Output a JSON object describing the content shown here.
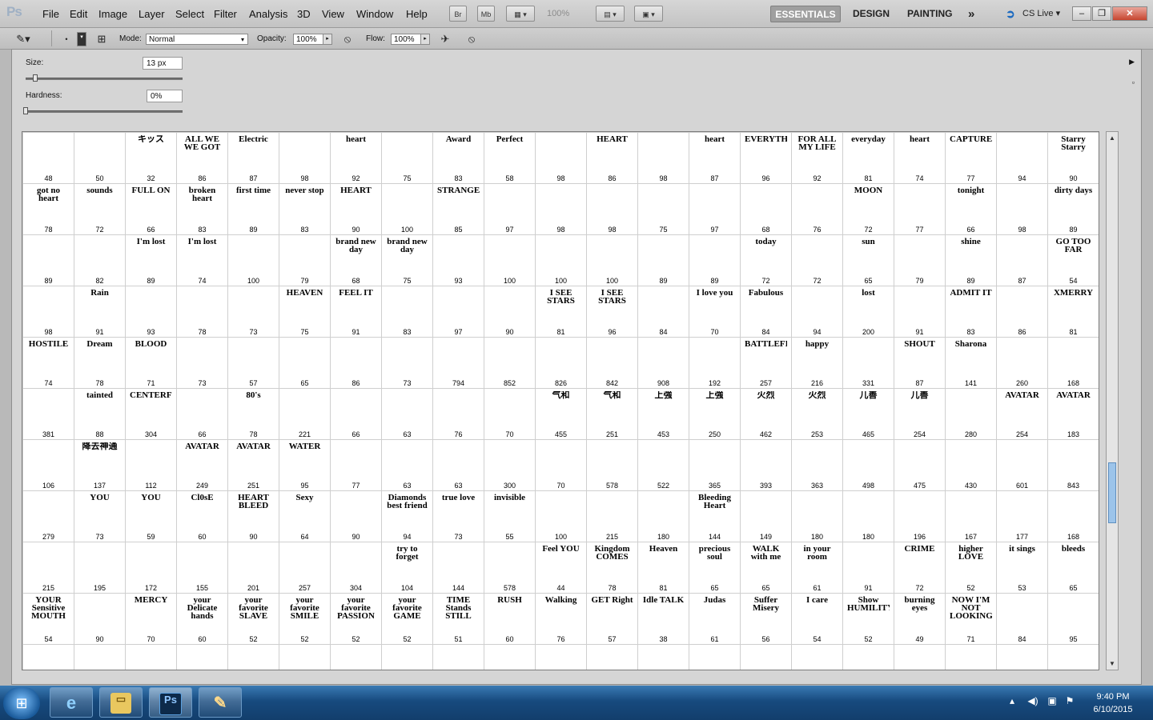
{
  "app": {
    "logo": "Ps"
  },
  "menu": [
    "File",
    "Edit",
    "Image",
    "Layer",
    "Select",
    "Filter",
    "Analysis",
    "3D",
    "View",
    "Window",
    "Help"
  ],
  "toolbar": {
    "bridge": "Br",
    "minibridge": "Mb",
    "zoom": "100%"
  },
  "workspaces": [
    "ESSENTIALS",
    "DESIGN",
    "PAINTING"
  ],
  "cs_live": "CS Live",
  "options": {
    "mode_label": "Mode:",
    "mode_value": "Normal",
    "opacity_label": "Opacity:",
    "opacity_value": "100%",
    "flow_label": "Flow:",
    "flow_value": "100%"
  },
  "brush_panel": {
    "size_label": "Size:",
    "size_value": "13 px",
    "hardness_label": "Hardness:",
    "hardness_value": "0%"
  },
  "brush_sizes": [
    [
      48,
      50,
      32,
      86,
      87,
      98,
      92,
      75,
      83,
      58,
      98,
      86,
      98,
      87,
      96,
      92,
      81,
      74,
      77,
      94,
      90
    ],
    [
      78,
      72,
      66,
      83,
      89,
      83,
      90,
      100,
      85,
      97,
      98,
      98,
      75,
      97,
      68,
      76,
      72,
      77,
      66,
      98,
      89
    ],
    [
      89,
      82,
      89,
      74,
      100,
      79,
      68,
      75,
      93,
      100,
      100,
      100,
      89,
      89,
      72,
      72,
      65,
      79,
      89,
      87,
      54
    ],
    [
      98,
      91,
      93,
      78,
      73,
      75,
      91,
      83,
      97,
      90,
      81,
      96,
      84,
      70,
      84,
      94,
      200,
      91,
      83,
      86,
      81
    ],
    [
      74,
      78,
      71,
      73,
      57,
      65,
      86,
      73,
      794,
      852,
      826,
      842,
      908,
      192,
      257,
      216,
      331,
      87,
      141,
      260,
      168
    ],
    [
      381,
      88,
      304,
      66,
      78,
      221,
      66,
      63,
      76,
      70,
      455,
      251,
      453,
      250,
      462,
      253,
      465,
      254,
      280,
      254,
      183
    ],
    [
      106,
      137,
      112,
      249,
      251,
      95,
      77,
      63,
      63,
      300,
      70,
      578,
      522,
      365,
      393,
      363,
      498,
      475,
      430,
      601,
      843
    ],
    [
      279,
      73,
      59,
      60,
      90,
      64,
      90,
      94,
      73,
      55,
      100,
      215,
      180,
      144,
      149,
      180,
      180,
      196,
      167,
      177,
      168
    ],
    [
      215,
      195,
      172,
      155,
      201,
      257,
      304,
      104,
      144,
      578,
      44,
      78,
      81,
      65,
      65,
      61,
      91,
      72,
      52,
      53,
      65
    ],
    [
      54,
      90,
      70,
      60,
      52,
      52,
      52,
      52,
      51,
      60,
      76,
      57,
      38,
      61,
      56,
      54,
      52,
      49,
      71,
      84,
      95
    ],
    [
      "",
      "",
      "",
      "",
      "",
      "",
      "",
      "",
      "",
      "",
      "",
      "",
      "",
      "",
      "",
      "",
      "",
      "",
      "",
      "",
      ""
    ]
  ],
  "brush_labels": [
    [
      "",
      "",
      "キッス",
      "ALL WE WE GOT",
      "Electric",
      "",
      "heart",
      "",
      "Award",
      "Perfect",
      "",
      "HEART",
      "",
      "heart",
      "EVERYTHING",
      "FOR ALL MY LIFE",
      "everyday",
      "heart",
      "CAPTURED",
      "",
      "Starry Starry"
    ],
    [
      "got no heart",
      "sounds",
      "FULL ON",
      "broken heart",
      "first time",
      "never stop",
      "HEART",
      "",
      "STRANGER",
      "",
      "",
      "",
      "",
      "",
      "",
      "",
      "MOON",
      "",
      "tonight",
      "",
      "dirty days"
    ],
    [
      "",
      "",
      "I'm lost",
      "I'm lost",
      "",
      "",
      "brand new day",
      "brand new day",
      "",
      "",
      "",
      "",
      "",
      "",
      "today",
      "",
      "sun",
      "",
      "shine",
      "",
      "GO TOO FAR"
    ],
    [
      "",
      "Rain",
      "",
      "",
      "",
      "HEAVEN",
      "FEEL IT",
      "",
      "",
      "",
      "I SEE STARS",
      "I SEE STARS",
      "",
      "I love you",
      "Fabulous",
      "",
      "lost",
      "",
      "ADMIT IT",
      "",
      "XMERRY"
    ],
    [
      "HOSTILE",
      "Dream",
      "BLOOD",
      "",
      "",
      "",
      "",
      "",
      "",
      "",
      "",
      "",
      "",
      "",
      "BATTLEFIELD",
      "happy",
      "",
      "SHOUT",
      "Sharona",
      "",
      ""
    ],
    [
      "",
      "tainted",
      "CENTERFOLD",
      "",
      "80's",
      "",
      "",
      "",
      "",
      "",
      "气和",
      "气和",
      "上強",
      "上強",
      "火烈",
      "火烈",
      "儿善",
      "儿善",
      "",
      "AVATAR",
      "AVATAR"
    ],
    [
      "",
      "降去神通",
      "",
      "AVATAR",
      "AVATAR",
      "WATER",
      "",
      "",
      "",
      "",
      "",
      "",
      "",
      "",
      "",
      "",
      "",
      "",
      "",
      "",
      ""
    ],
    [
      "",
      "YOU",
      "YOU",
      "Cl0sE",
      "HEART BLEED",
      "Sexy",
      "",
      "Diamonds best friend",
      "true love",
      "invisible",
      "",
      "",
      "",
      "Bleeding Heart",
      "",
      "",
      "",
      "",
      "",
      "",
      ""
    ],
    [
      "",
      "",
      "",
      "",
      "",
      "",
      "",
      "try to forget",
      "",
      "",
      "Feel YOU",
      "Kingdom COMES",
      "Heaven",
      "precious soul",
      "WALK with me",
      "in your room",
      "",
      "CRIME",
      "higher LOVE",
      "it sings",
      "bleeds"
    ],
    [
      "YOUR Sensitive MOUTH",
      "",
      "MERCY",
      "your Delicate hands",
      "your favorite SLAVE",
      "your favorite SMILE",
      "your favorite PASSION",
      "your favorite GAME",
      "TIME Stands STILL",
      "RUSH",
      "Walking",
      "GET Right",
      "Idle TALK",
      "Judas",
      "Suffer Misery",
      "I care",
      "Show HUMILITY",
      "burning eyes",
      "NOW I'M NOT LOOKING",
      "",
      ""
    ],
    [
      "",
      "",
      "",
      "",
      "",
      "",
      "",
      "",
      "",
      "",
      "",
      "",
      "",
      "",
      "",
      "",
      "",
      "",
      "",
      "",
      ""
    ]
  ],
  "taskbar": {
    "photoshop_label": "Ps"
  },
  "clock": {
    "time": "9:40 PM",
    "date": "6/10/2015"
  }
}
